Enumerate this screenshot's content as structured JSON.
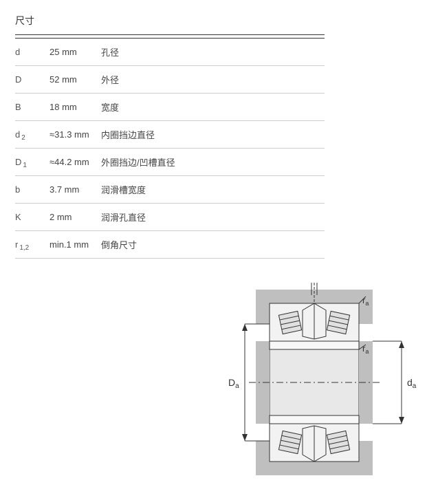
{
  "title": "尺寸",
  "rows": [
    {
      "symbol": "d",
      "sub": "",
      "value": "25 mm",
      "desc": "孔径"
    },
    {
      "symbol": "D",
      "sub": "",
      "value": "52 mm",
      "desc": "外径"
    },
    {
      "symbol": "B",
      "sub": "",
      "value": "18 mm",
      "desc": "宽度"
    },
    {
      "symbol": "d",
      "sub": "2",
      "value": "≈31.3 mm",
      "desc": "内圈挡边直径"
    },
    {
      "symbol": "D",
      "sub": "1",
      "value": "≈44.2 mm",
      "desc": "外圈挡边/凹槽直径"
    },
    {
      "symbol": "b",
      "sub": "",
      "value": "3.7 mm",
      "desc": "润滑槽宽度"
    },
    {
      "symbol": "K",
      "sub": "",
      "value": "2 mm",
      "desc": "润滑孔直径"
    },
    {
      "symbol": "r",
      "sub": "1,2",
      "value": "min.1 mm",
      "desc": "倒角尺寸"
    }
  ],
  "diagram": {
    "label_Da": "D",
    "label_Da_sub": "a",
    "label_da": "d",
    "label_da_sub": "a",
    "label_ra": "r",
    "label_ra_sub": "a"
  }
}
